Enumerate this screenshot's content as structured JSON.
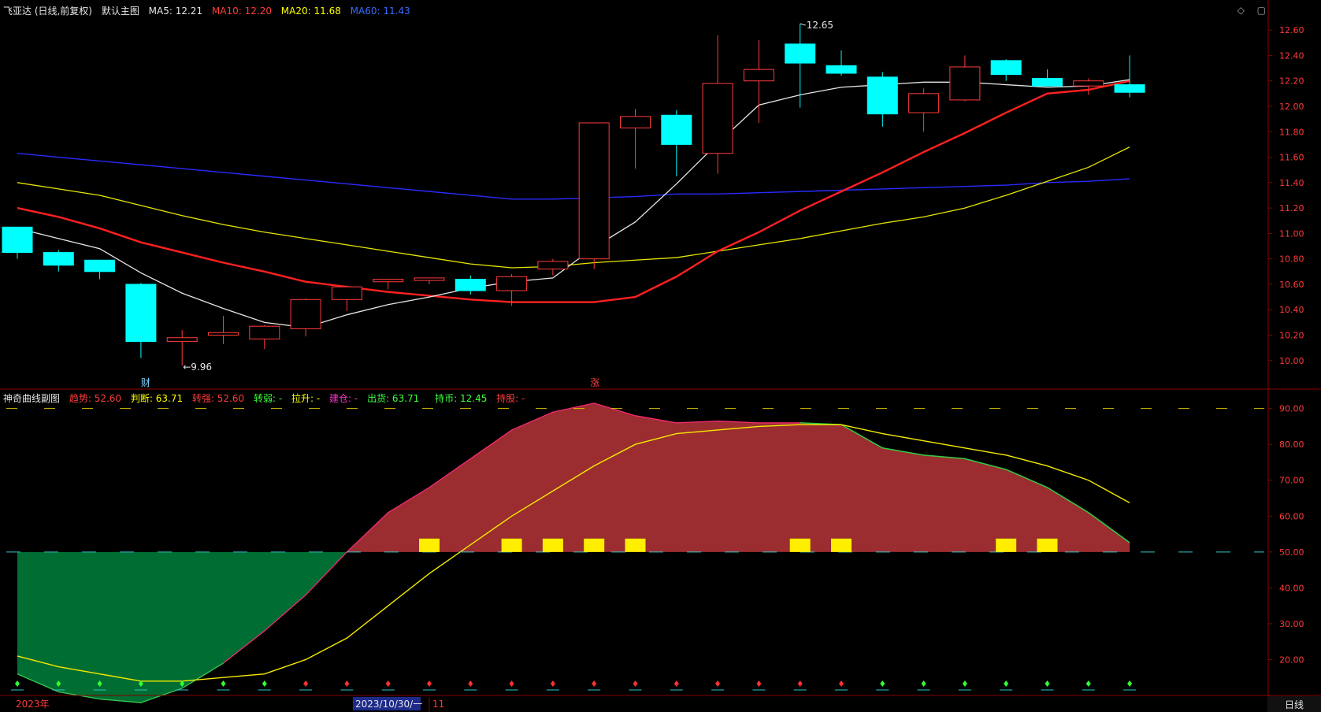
{
  "main_header": {
    "symbol": "飞亚达 (日线,前复权)",
    "template": "默认主图",
    "ma5": "MA5: 12.21",
    "ma10": "MA10: 12.20",
    "ma20": "MA20: 11.68",
    "ma60": "MA60: 11.43"
  },
  "sub_header": {
    "name": "神奇曲线副图",
    "trend": "趋势: 52.60",
    "judge": "判断: 63.71",
    "strong": "转强: 52.60",
    "weak": "转弱: -",
    "lift": "拉升: -",
    "build": "建仓: -",
    "ship": "出货: 63.71",
    "hold": "持币: 12.45",
    "holdshare": "持股: -"
  },
  "corner_icons": [
    "diamond-icon",
    "window-restore-icon"
  ],
  "footer": {
    "year_label": "2023年",
    "date_label": "2023/10/30/一",
    "month_label": "11",
    "period_button": "日线"
  },
  "annotations": {
    "high_label": "12.65",
    "low_label": "←9.96",
    "cai_marker": "财",
    "zhang_marker": "涨"
  },
  "colors": {
    "up": "#ff3b3b",
    "down": "#00ffff",
    "ma5": "#e6e6e6",
    "ma10": "#ff2020",
    "ma20": "#e6e600",
    "ma60": "#2a2aff",
    "axis": "#8a0000",
    "fill_red": "#9b2d30",
    "fill_green": "#006d32",
    "marker_yellow": "#ffee00"
  },
  "chart_data": [
    {
      "type": "candlestick",
      "title": "飞亚达 (日线,前复权)",
      "ylim": [
        9.85,
        12.7
      ],
      "y_ticks": [
        "12.60",
        "12.40",
        "12.20",
        "12.00",
        "11.80",
        "11.60",
        "11.40",
        "11.20",
        "11.00",
        "10.80",
        "10.60",
        "10.40",
        "10.20",
        "10.00"
      ],
      "candles": [
        {
          "o": 11.05,
          "h": 11.05,
          "l": 10.8,
          "c": 10.85
        },
        {
          "o": 10.85,
          "h": 10.87,
          "l": 10.7,
          "c": 10.75
        },
        {
          "o": 10.79,
          "h": 10.79,
          "l": 10.64,
          "c": 10.7
        },
        {
          "o": 10.6,
          "h": 10.61,
          "l": 10.02,
          "c": 10.15
        },
        {
          "o": 10.15,
          "h": 10.24,
          "l": 9.96,
          "c": 10.18
        },
        {
          "o": 10.2,
          "h": 10.35,
          "l": 10.13,
          "c": 10.22
        },
        {
          "o": 10.17,
          "h": 10.28,
          "l": 10.09,
          "c": 10.27
        },
        {
          "o": 10.25,
          "h": 10.49,
          "l": 10.19,
          "c": 10.48
        },
        {
          "o": 10.48,
          "h": 10.59,
          "l": 10.39,
          "c": 10.58
        },
        {
          "o": 10.62,
          "h": 10.64,
          "l": 10.56,
          "c": 10.64
        },
        {
          "o": 10.63,
          "h": 10.65,
          "l": 10.6,
          "c": 10.65
        },
        {
          "o": 10.64,
          "h": 10.67,
          "l": 10.52,
          "c": 10.55
        },
        {
          "o": 10.55,
          "h": 10.68,
          "l": 10.43,
          "c": 10.66
        },
        {
          "o": 10.72,
          "h": 10.8,
          "l": 10.67,
          "c": 10.78
        },
        {
          "o": 10.8,
          "h": 11.87,
          "l": 10.72,
          "c": 11.87
        },
        {
          "o": 11.83,
          "h": 11.98,
          "l": 11.51,
          "c": 11.92
        },
        {
          "o": 11.93,
          "h": 11.97,
          "l": 11.45,
          "c": 11.7
        },
        {
          "o": 11.63,
          "h": 12.56,
          "l": 11.47,
          "c": 12.18
        },
        {
          "o": 12.2,
          "h": 12.52,
          "l": 11.87,
          "c": 12.29
        },
        {
          "o": 12.49,
          "h": 12.65,
          "l": 11.99,
          "c": 12.34
        },
        {
          "o": 12.32,
          "h": 12.44,
          "l": 12.24,
          "c": 12.26
        },
        {
          "o": 12.23,
          "h": 12.27,
          "l": 11.84,
          "c": 11.94
        },
        {
          "o": 11.95,
          "h": 12.14,
          "l": 11.8,
          "c": 12.1
        },
        {
          "o": 12.05,
          "h": 12.4,
          "l": 12.04,
          "c": 12.31
        },
        {
          "o": 12.36,
          "h": 12.37,
          "l": 12.2,
          "c": 12.25
        },
        {
          "o": 12.22,
          "h": 12.29,
          "l": 12.15,
          "c": 12.16
        },
        {
          "o": 12.16,
          "h": 12.22,
          "l": 12.09,
          "c": 12.2
        },
        {
          "o": 12.17,
          "h": 12.4,
          "l": 12.07,
          "c": 12.11
        }
      ],
      "series": [
        {
          "name": "MA5",
          "values": [
            11.04,
            10.96,
            10.88,
            10.69,
            10.53,
            10.41,
            10.3,
            10.26,
            10.36,
            10.44,
            10.5,
            10.57,
            10.62,
            10.65,
            10.89,
            11.09,
            11.39,
            11.71,
            12.01,
            12.09,
            12.15,
            12.17,
            12.19,
            12.19,
            12.17,
            12.15,
            12.16,
            12.21
          ]
        },
        {
          "name": "MA10",
          "values": [
            11.2,
            11.13,
            11.04,
            10.93,
            10.85,
            10.77,
            10.7,
            10.62,
            10.58,
            10.54,
            10.51,
            10.48,
            10.46,
            10.46,
            10.46,
            10.5,
            10.66,
            10.86,
            11.01,
            11.18,
            11.33,
            11.48,
            11.64,
            11.79,
            11.95,
            12.1,
            12.13,
            12.2
          ]
        },
        {
          "name": "MA20",
          "values": [
            11.4,
            11.35,
            11.3,
            11.22,
            11.14,
            11.07,
            11.01,
            10.96,
            10.91,
            10.86,
            10.81,
            10.76,
            10.73,
            10.74,
            10.77,
            10.79,
            10.81,
            10.86,
            10.91,
            10.96,
            11.02,
            11.08,
            11.13,
            11.2,
            11.3,
            11.41,
            11.52,
            11.68
          ]
        },
        {
          "name": "MA60",
          "values": [
            11.63,
            11.6,
            11.57,
            11.54,
            11.51,
            11.48,
            11.45,
            11.42,
            11.39,
            11.36,
            11.33,
            11.3,
            11.27,
            11.27,
            11.28,
            11.29,
            11.31,
            11.31,
            11.32,
            11.33,
            11.34,
            11.35,
            11.36,
            11.37,
            11.38,
            11.4,
            11.41,
            11.43
          ]
        }
      ]
    },
    {
      "type": "area",
      "title": "神奇曲线副图",
      "ylim": [
        10,
        93
      ],
      "y_ticks": [
        "90.00",
        "80.00",
        "70.00",
        "60.00",
        "50.00",
        "40.00",
        "30.00",
        "20.00"
      ],
      "baseline": 50,
      "upper_level": 90,
      "series": [
        {
          "name": "趋势",
          "values": [
            16,
            11,
            9,
            8,
            12,
            19,
            28,
            38,
            50,
            61,
            68,
            76,
            84,
            89,
            91.5,
            88,
            86,
            86.5,
            86,
            86,
            85.5,
            79,
            77,
            76,
            73,
            68,
            61,
            52.6
          ]
        },
        {
          "name": "判断",
          "values": [
            21,
            18,
            16,
            14,
            14,
            15,
            16,
            20,
            26,
            35,
            44,
            52,
            60,
            67,
            74,
            80,
            83,
            84,
            85,
            85.5,
            85.5,
            83,
            81,
            79,
            77,
            74,
            70,
            63.71
          ]
        },
        {
          "name": "持币",
          "values": [
            10,
            10,
            10,
            10,
            10,
            10,
            10,
            12,
            16,
            22,
            30,
            40,
            50,
            60,
            70,
            80,
            83,
            84,
            85,
            85.5,
            85.5,
            82,
            80,
            78,
            76,
            73,
            68,
            12.45
          ]
        }
      ],
      "yellow_markers_at_bar": [
        10,
        12,
        13,
        14,
        15,
        19,
        20,
        24,
        25
      ],
      "bottom_dots": [
        {
          "i": 0,
          "c": "g"
        },
        {
          "i": 1,
          "c": "g"
        },
        {
          "i": 2,
          "c": "g"
        },
        {
          "i": 3,
          "c": "g"
        },
        {
          "i": 4,
          "c": "g"
        },
        {
          "i": 5,
          "c": "g"
        },
        {
          "i": 6,
          "c": "g"
        },
        {
          "i": 7,
          "c": "r"
        },
        {
          "i": 8,
          "c": "r"
        },
        {
          "i": 9,
          "c": "r"
        },
        {
          "i": 10,
          "c": "r"
        },
        {
          "i": 11,
          "c": "r"
        },
        {
          "i": 12,
          "c": "r"
        },
        {
          "i": 13,
          "c": "r"
        },
        {
          "i": 14,
          "c": "r"
        },
        {
          "i": 15,
          "c": "r"
        },
        {
          "i": 16,
          "c": "r"
        },
        {
          "i": 17,
          "c": "r"
        },
        {
          "i": 18,
          "c": "r"
        },
        {
          "i": 19,
          "c": "r"
        },
        {
          "i": 20,
          "c": "r"
        },
        {
          "i": 21,
          "c": "g"
        },
        {
          "i": 22,
          "c": "g"
        },
        {
          "i": 23,
          "c": "g"
        },
        {
          "i": 24,
          "c": "g"
        },
        {
          "i": 25,
          "c": "g"
        },
        {
          "i": 26,
          "c": "g"
        },
        {
          "i": 27,
          "c": "g"
        }
      ]
    }
  ]
}
